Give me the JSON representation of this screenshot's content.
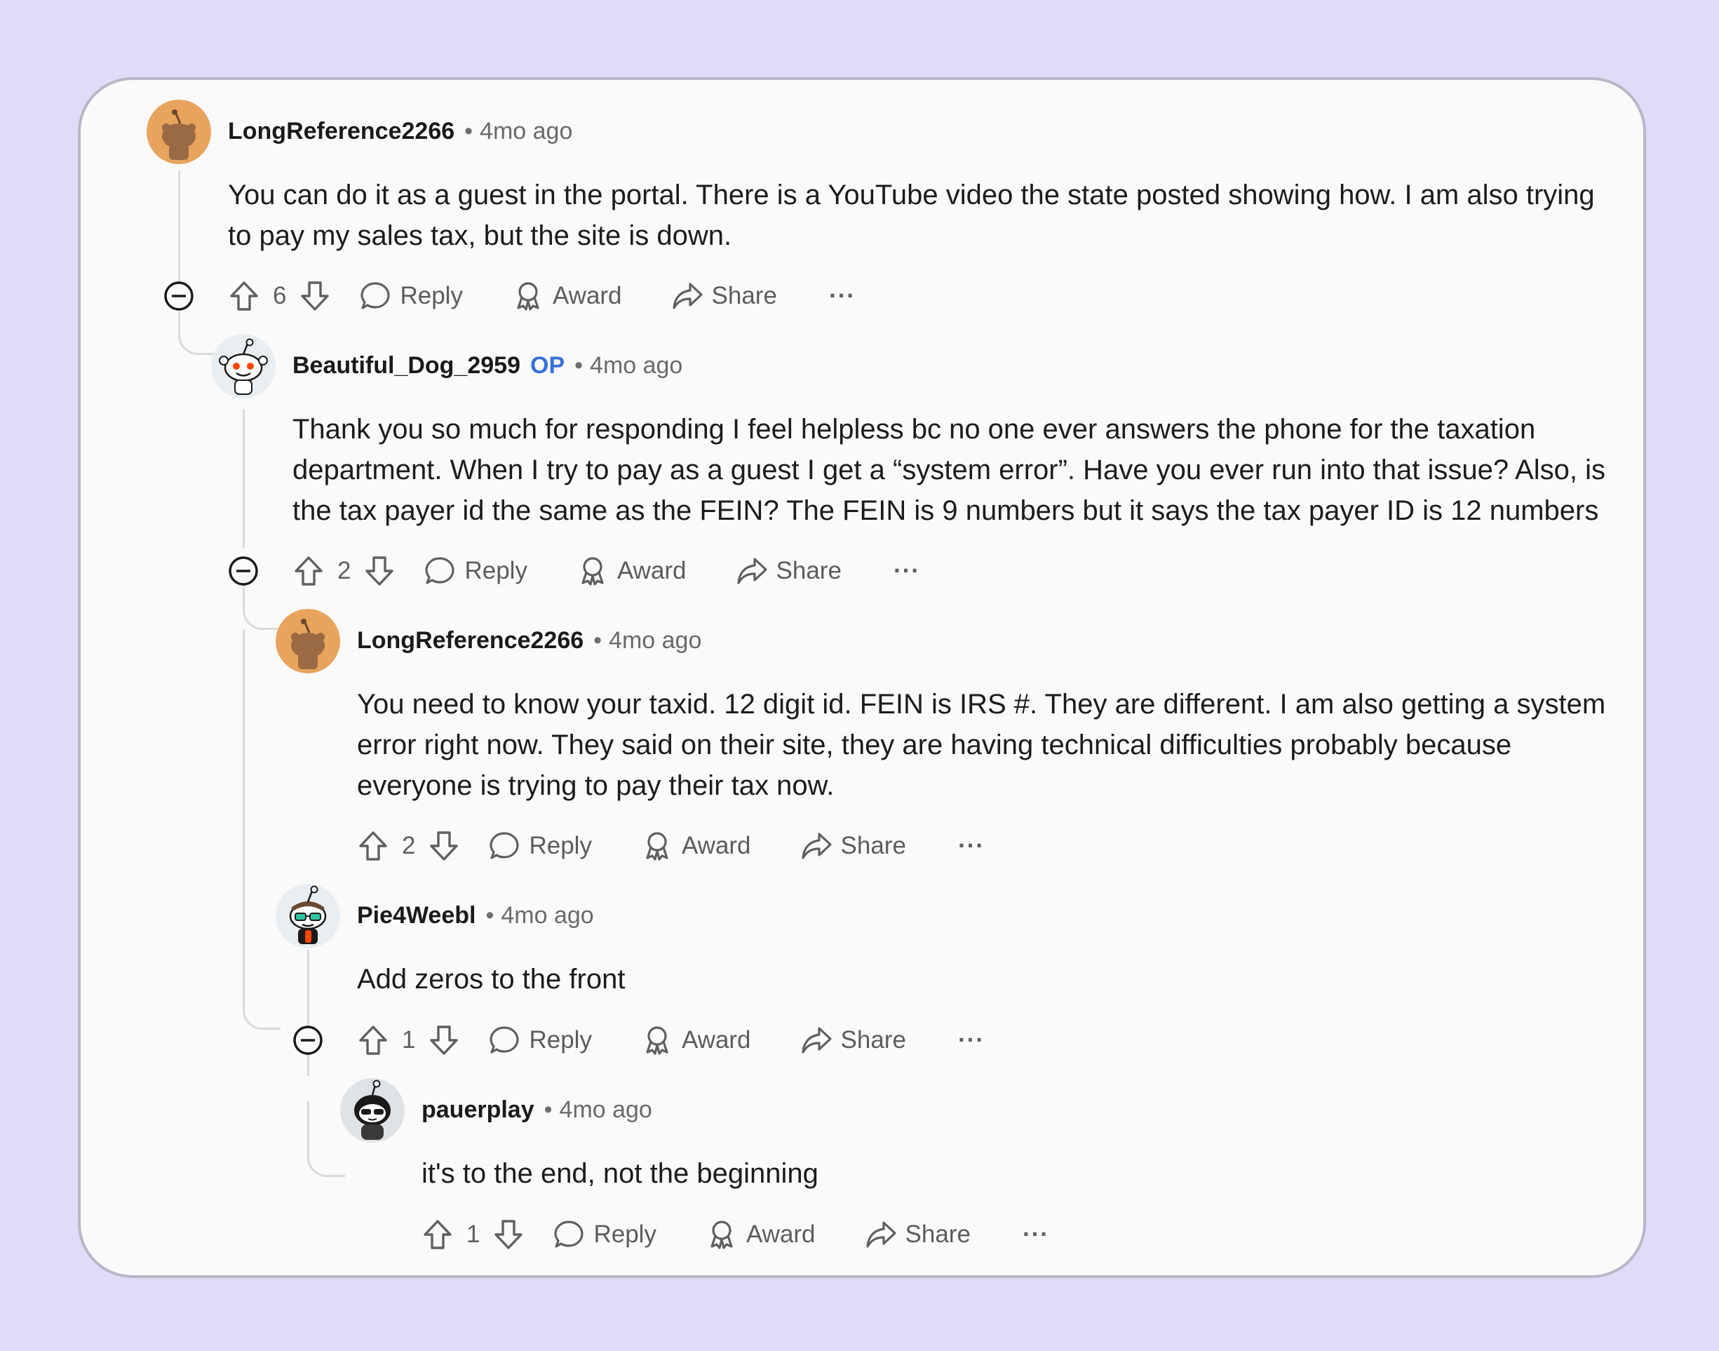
{
  "comments": [
    {
      "username": "LongReference2266",
      "op_label": "",
      "sep": "•",
      "time": "4mo ago",
      "body": "You can do it as a guest in the portal. There is a YouTube video the state posted showing how. I am also trying to pay my sales tax, but the site is down.",
      "votes": "6",
      "reply": "Reply",
      "award": "Award",
      "share": "Share",
      "more": "···",
      "avatar_color": "#e8a35c"
    },
    {
      "username": "Beautiful_Dog_2959",
      "op_label": "OP",
      "sep": "•",
      "time": "4mo ago",
      "body": "Thank you so much for responding I feel helpless bc no one ever answers the phone for the taxation department. When I try to pay as a guest I get a “system error”. Have you ever run into that issue? Also, is the tax payer id the same as the FEIN? The FEIN is 9 numbers but it says the tax payer ID is 12 numbers",
      "votes": "2",
      "reply": "Reply",
      "award": "Award",
      "share": "Share",
      "more": "···",
      "avatar_color": "#e9eef2"
    },
    {
      "username": "LongReference2266",
      "op_label": "",
      "sep": "•",
      "time": "4mo ago",
      "body": "You need to know your taxid. 12 digit id. FEIN is IRS #. They are different. I am also getting a system error right now. They said on their site, they are having technical difficulties probably because everyone is trying to pay their tax now.",
      "votes": "2",
      "reply": "Reply",
      "award": "Award",
      "share": "Share",
      "more": "···",
      "avatar_color": "#e8a35c"
    },
    {
      "username": "Pie4Weebl",
      "op_label": "",
      "sep": "•",
      "time": "4mo ago",
      "body": "Add zeros to the front",
      "votes": "1",
      "reply": "Reply",
      "award": "Award",
      "share": "Share",
      "more": "···",
      "avatar_color": "#e9eef2"
    },
    {
      "username": "pauerplay",
      "op_label": "",
      "sep": "•",
      "time": "4mo ago",
      "body": "it's to the end, not the beginning",
      "votes": "1",
      "reply": "Reply",
      "award": "Award",
      "share": "Share",
      "more": "···",
      "avatar_color": "#dfe3e6"
    }
  ],
  "icons": {
    "collapse": "collapse-minus-icon",
    "upvote": "upvote-arrow-icon",
    "downvote": "downvote-arrow-icon",
    "reply": "speech-bubble-icon",
    "award": "award-ribbon-icon",
    "share": "share-arrow-icon"
  }
}
